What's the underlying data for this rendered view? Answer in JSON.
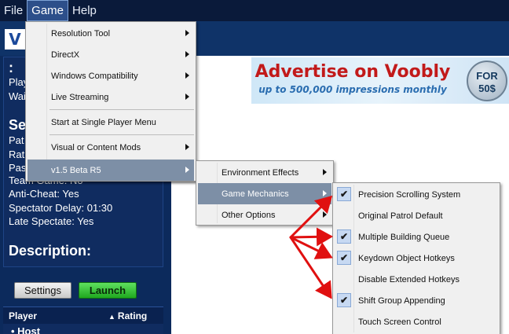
{
  "menubar": {
    "items": [
      "File",
      "Game",
      "Help"
    ],
    "active_index": 1
  },
  "logo": {
    "letter": "V"
  },
  "info": {
    "colon": ":",
    "line1": "Play",
    "line2": "Wai",
    "section_label": "Se",
    "line3": "Pat",
    "line4": "Rat",
    "line5": "Pas",
    "line6": "Team Game: No",
    "anti_cheat": "Anti-Cheat: Yes",
    "spectator_delay": "Spectator Delay: 01:30",
    "late_spectate": "Late Spectate: Yes",
    "description_label": "Description:"
  },
  "buttons": {
    "settings": "Settings",
    "launch": "Launch"
  },
  "table": {
    "col_player": "Player",
    "col_rating": "Rating",
    "row_host": "Host"
  },
  "banner": {
    "title": "Advertise on Voobly",
    "subtitle": "up to 500,000 impressions monthly",
    "badge_line1": "FOR",
    "badge_line2": "50$"
  },
  "game_menu": {
    "items": [
      {
        "label": "Resolution Tool",
        "submenu": true
      },
      {
        "label": "DirectX",
        "submenu": true
      },
      {
        "label": "Windows Compatibility",
        "submenu": true
      },
      {
        "label": "Live Streaming",
        "submenu": true
      },
      {
        "label": "Start at Single Player Menu",
        "submenu": false
      },
      {
        "label": "Visual or Content Mods",
        "submenu": true
      },
      {
        "label": "v1.5 Beta R5",
        "submenu": true
      }
    ]
  },
  "version_menu": {
    "items": [
      {
        "label": "Environment Effects",
        "submenu": true
      },
      {
        "label": "Game Mechanics",
        "submenu": true
      },
      {
        "label": "Other Options",
        "submenu": true
      }
    ]
  },
  "mechanics_menu": {
    "items": [
      {
        "label": "Precision Scrolling System",
        "checked": true
      },
      {
        "label": "Original Patrol Default",
        "checked": false
      },
      {
        "label": "Multiple Building Queue",
        "checked": true
      },
      {
        "label": "Keydown Object Hotkeys",
        "checked": true
      },
      {
        "label": "Disable Extended Hotkeys",
        "checked": false
      },
      {
        "label": "Shift Group Appending",
        "checked": true
      },
      {
        "label": "Touch Screen Control",
        "checked": false
      }
    ],
    "check_glyph": "✔"
  },
  "colors": {
    "menubar_bg": "#0a1a3a",
    "panel_bg": "#0c2a5c",
    "launch_green": "#1fa81f",
    "annotation_arrow": "#e01010",
    "menu_highlight": "#7d8fa6"
  }
}
